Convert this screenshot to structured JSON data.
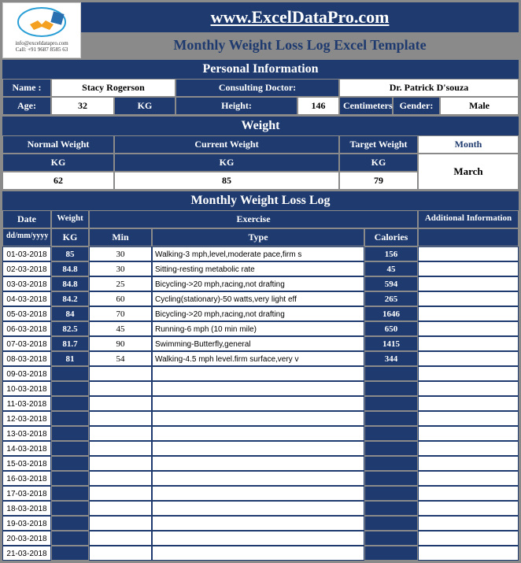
{
  "header": {
    "site_url": "www.ExcelDataPro.com",
    "template_title": "Monthly Weight Loss Log Excel Template",
    "logo_email": "info@exceldatapro.com",
    "logo_phone": "Call: +91 9687 8585 63"
  },
  "sections": {
    "personal_info": "Personal Information",
    "weight": "Weight",
    "log": "Monthly Weight Loss Log"
  },
  "personal": {
    "name_label": "Name :",
    "name_value": "Stacy Rogerson",
    "doctor_label": "Consulting Doctor:",
    "doctor_value": "Dr. Patrick D'souza",
    "age_label": "Age:",
    "age_value": "32",
    "age_unit": "KG",
    "height_label": "Height:",
    "height_value": "146",
    "height_unit": "Centimeters",
    "gender_label": "Gender:",
    "gender_value": "Male"
  },
  "weight": {
    "normal_label": "Normal Weight",
    "current_label": "Current Weight",
    "target_label": "Target Weight",
    "month_label": "Month",
    "unit": "KG",
    "normal_value": "62",
    "current_value": "85",
    "target_value": "79",
    "month_value": "March"
  },
  "log_headers": {
    "date": "Date",
    "weight": "Weight",
    "exercise": "Exercise",
    "additional": "Additional Information",
    "date_fmt": "dd/mm/yyyy",
    "kg": "KG",
    "min": "Min",
    "type": "Type",
    "calories": "Calories"
  },
  "log_rows": [
    {
      "date": "01-03-2018",
      "weight": "85",
      "min": "30",
      "type": "Walking-3 mph,level,moderate pace,firm s",
      "cal": "156",
      "add": ""
    },
    {
      "date": "02-03-2018",
      "weight": "84.8",
      "min": "30",
      "type": "Sitting-resting metabolic rate",
      "cal": "45",
      "add": ""
    },
    {
      "date": "03-03-2018",
      "weight": "84.8",
      "min": "25",
      "type": "Bicycling->20 mph,racing,not drafting",
      "cal": "594",
      "add": ""
    },
    {
      "date": "04-03-2018",
      "weight": "84.2",
      "min": "60",
      "type": "Cycling(stationary)-50 watts,very light eff",
      "cal": "265",
      "add": ""
    },
    {
      "date": "05-03-2018",
      "weight": "84",
      "min": "70",
      "type": "Bicycling->20 mph,racing,not drafting",
      "cal": "1646",
      "add": ""
    },
    {
      "date": "06-03-2018",
      "weight": "82.5",
      "min": "45",
      "type": "Running-6 mph (10 min mile)",
      "cal": "650",
      "add": ""
    },
    {
      "date": "07-03-2018",
      "weight": "81.7",
      "min": "90",
      "type": "Swimming-Butterfly,general",
      "cal": "1415",
      "add": ""
    },
    {
      "date": "08-03-2018",
      "weight": "81",
      "min": "54",
      "type": "Walking-4.5 mph level.firm surface,very v",
      "cal": "344",
      "add": ""
    },
    {
      "date": "09-03-2018",
      "weight": "",
      "min": "",
      "type": "",
      "cal": "",
      "add": ""
    },
    {
      "date": "10-03-2018",
      "weight": "",
      "min": "",
      "type": "",
      "cal": "",
      "add": ""
    },
    {
      "date": "11-03-2018",
      "weight": "",
      "min": "",
      "type": "",
      "cal": "",
      "add": ""
    },
    {
      "date": "12-03-2018",
      "weight": "",
      "min": "",
      "type": "",
      "cal": "",
      "add": ""
    },
    {
      "date": "13-03-2018",
      "weight": "",
      "min": "",
      "type": "",
      "cal": "",
      "add": ""
    },
    {
      "date": "14-03-2018",
      "weight": "",
      "min": "",
      "type": "",
      "cal": "",
      "add": ""
    },
    {
      "date": "15-03-2018",
      "weight": "",
      "min": "",
      "type": "",
      "cal": "",
      "add": ""
    },
    {
      "date": "16-03-2018",
      "weight": "",
      "min": "",
      "type": "",
      "cal": "",
      "add": ""
    },
    {
      "date": "17-03-2018",
      "weight": "",
      "min": "",
      "type": "",
      "cal": "",
      "add": ""
    },
    {
      "date": "18-03-2018",
      "weight": "",
      "min": "",
      "type": "",
      "cal": "",
      "add": ""
    },
    {
      "date": "19-03-2018",
      "weight": "",
      "min": "",
      "type": "",
      "cal": "",
      "add": ""
    },
    {
      "date": "20-03-2018",
      "weight": "",
      "min": "",
      "type": "",
      "cal": "",
      "add": ""
    },
    {
      "date": "21-03-2018",
      "weight": "",
      "min": "",
      "type": "",
      "cal": "",
      "add": ""
    }
  ]
}
